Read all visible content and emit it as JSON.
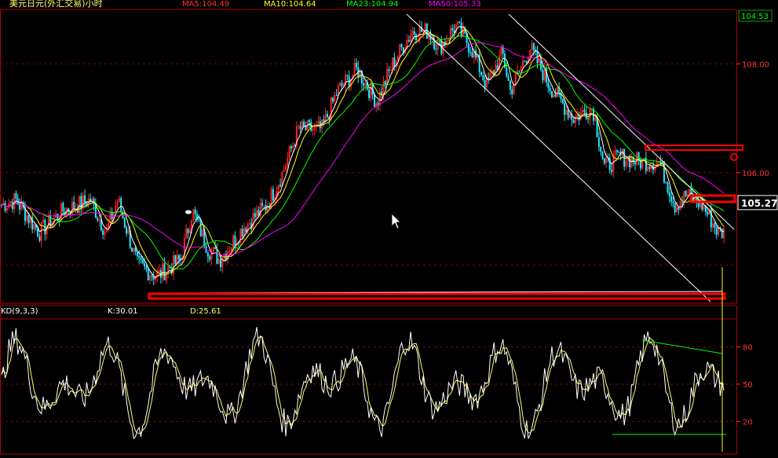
{
  "window": {
    "title": "美元日元(外汇交易)小时"
  },
  "colors": {
    "background": "#000000",
    "grid": "#8b0000",
    "frame": "#b00000",
    "up_candle": "#ff2020",
    "down_candle": "#1ee8ff",
    "ma5": "#ffffff",
    "ma10": "#ffff00",
    "ma23": "#00ff00",
    "ma50": "#ff00ff",
    "k_line": "#ffffff",
    "d_line": "#ffff66",
    "channel": "#ffffff",
    "annotation": "#ff0000",
    "axis_text": "#ff3333",
    "last_price_box": "#ffffff"
  },
  "legend": [
    {
      "label": "MA5:104.49",
      "color": "#ff3030"
    },
    {
      "label": "MA10:104.64",
      "color": "#ffff00"
    },
    {
      "label": "MA23:104.94",
      "color": "#00ff00"
    },
    {
      "label": "MA50:105.33",
      "color": "#ff00ff"
    }
  ],
  "indicator": {
    "name": "KD(9,3,3)",
    "k_label": "K:30.01",
    "d_label": "D:25.61"
  },
  "axes": {
    "price_ticks": [
      "108.00",
      "106.00"
    ],
    "top_price": "104.53",
    "last_price": "105.27",
    "kd_ticks": [
      "80",
      "50",
      "20"
    ]
  },
  "chart_data": [
    {
      "type": "candlestick",
      "title": "美元日元(外汇交易)小时",
      "ylim": [
        103.6,
        109.0
      ],
      "y_ticks": [
        108.0,
        106.0
      ],
      "grid": true,
      "bars": 400,
      "price_path": [
        [
          0,
          105.4
        ],
        [
          20,
          105.5
        ],
        [
          50,
          104.9
        ],
        [
          80,
          105.3
        ],
        [
          115,
          105.5
        ],
        [
          135,
          104.9
        ],
        [
          150,
          105.5
        ],
        [
          175,
          104.3
        ],
        [
          200,
          104.1
        ],
        [
          230,
          104.4
        ],
        [
          245,
          105.3
        ],
        [
          265,
          104.6
        ],
        [
          280,
          104.4
        ],
        [
          310,
          105.0
        ],
        [
          340,
          105.4
        ],
        [
          360,
          106.0
        ],
        [
          380,
          106.8
        ],
        [
          410,
          106.8
        ],
        [
          430,
          107.5
        ],
        [
          455,
          107.9
        ],
        [
          480,
          107.3
        ],
        [
          500,
          108.0
        ],
        [
          525,
          108.6
        ],
        [
          545,
          108.6
        ],
        [
          560,
          108.3
        ],
        [
          580,
          108.7
        ],
        [
          600,
          108.3
        ],
        [
          620,
          107.6
        ],
        [
          640,
          108.2
        ],
        [
          650,
          107.5
        ],
        [
          675,
          108.3
        ],
        [
          700,
          107.6
        ],
        [
          730,
          107.0
        ],
        [
          755,
          107.2
        ],
        [
          770,
          106.1
        ],
        [
          790,
          106.3
        ],
        [
          815,
          106.2
        ],
        [
          840,
          106.2
        ],
        [
          860,
          105.4
        ],
        [
          875,
          105.6
        ],
        [
          895,
          105.4
        ],
        [
          915,
          104.9
        ],
        [
          925,
          104.9
        ]
      ],
      "series": [
        {
          "name": "MA5",
          "last": 104.49
        },
        {
          "name": "MA10",
          "last": 104.64
        },
        {
          "name": "MA23",
          "last": 104.94
        },
        {
          "name": "MA50",
          "last": 105.33
        }
      ]
    },
    {
      "type": "line",
      "title": "KD(9,3,3)",
      "ylim": [
        0,
        100
      ],
      "y_ticks": [
        80,
        50,
        20
      ],
      "series": [
        {
          "name": "K",
          "last": 30.01
        },
        {
          "name": "D",
          "last": 25.61
        }
      ]
    }
  ]
}
